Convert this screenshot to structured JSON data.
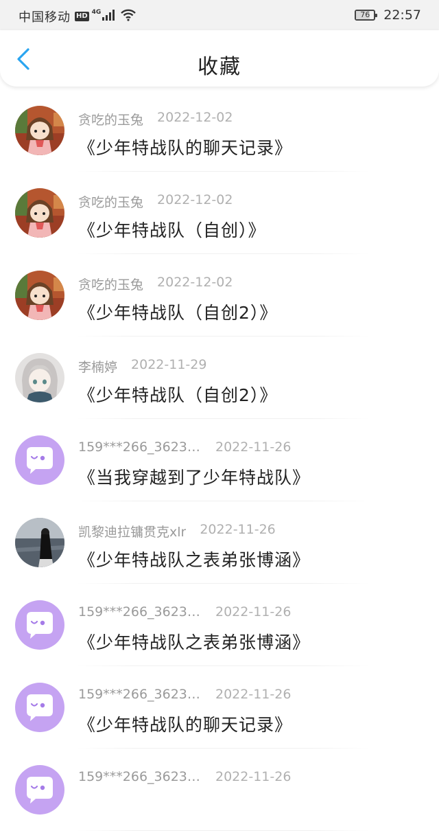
{
  "status_bar": {
    "carrier": "中国移动",
    "hd": "HD",
    "network": "4G",
    "battery": "76",
    "battery_level": 0.76,
    "time": "22:57"
  },
  "nav": {
    "title": "收藏"
  },
  "colors": {
    "accent": "#2aa5f0",
    "default_avatar_bg": "#c5a3f2"
  },
  "items": [
    {
      "author": "贪吃的玉兔",
      "date": "2022-12-02",
      "title": "《少年特战队的聊天记录》",
      "avatar": "anime-girl"
    },
    {
      "author": "贪吃的玉兔",
      "date": "2022-12-02",
      "title": "《少年特战队（自创）》",
      "avatar": "anime-girl"
    },
    {
      "author": "贪吃的玉兔",
      "date": "2022-12-02",
      "title": "《少年特战队（自创2）》",
      "avatar": "anime-girl"
    },
    {
      "author": "李楠婷",
      "date": "2022-11-29",
      "title": "《少年特战队（自创2）》",
      "avatar": "white-hair-girl"
    },
    {
      "author": "159***266_36234…",
      "date": "2022-11-26",
      "title": "《当我穿越到了少年特战队》",
      "avatar": "default-chat"
    },
    {
      "author": "凯黎迪拉镛贯克xlr",
      "date": "2022-11-26",
      "title": "《少年特战队之表弟张博涵》",
      "avatar": "sea-figure"
    },
    {
      "author": "159***266_36234…",
      "date": "2022-11-26",
      "title": "《少年特战队之表弟张博涵》",
      "avatar": "default-chat"
    },
    {
      "author": "159***266_36234…",
      "date": "2022-11-26",
      "title": "《少年特战队的聊天记录》",
      "avatar": "default-chat"
    },
    {
      "author": "159***266_36234…",
      "date": "2022-11-26",
      "title": "",
      "avatar": "default-chat"
    }
  ]
}
